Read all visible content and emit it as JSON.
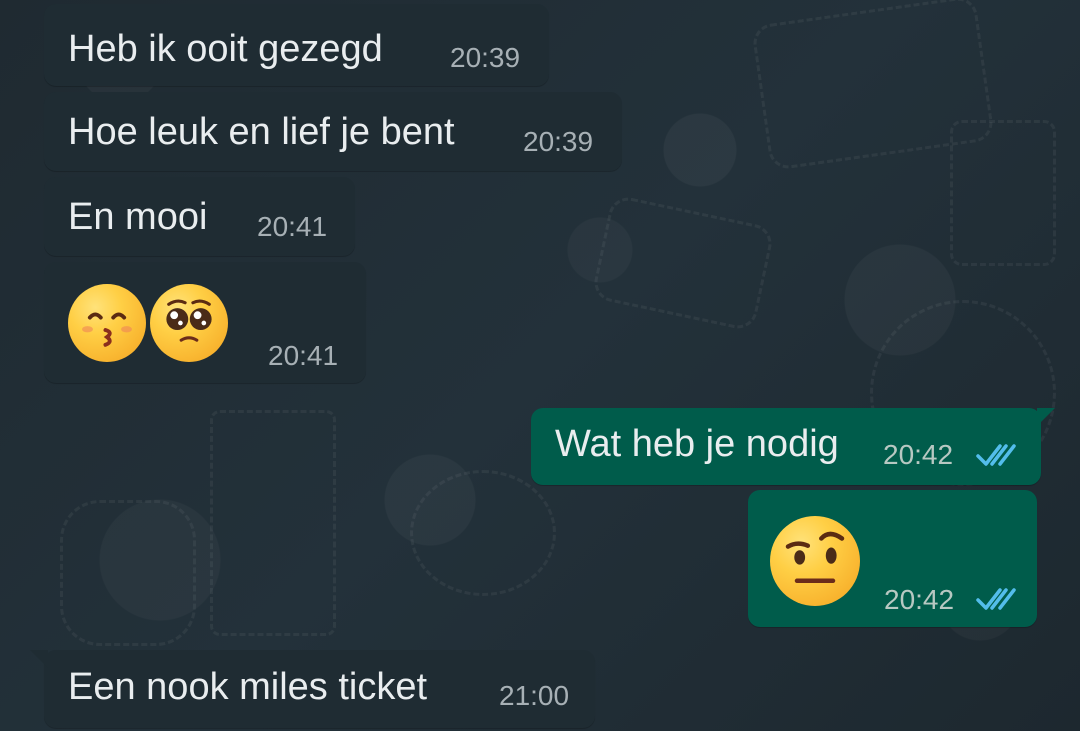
{
  "messages": [
    {
      "direction": "incoming",
      "text": "Heb ik ooit gezegd",
      "time": "20:39"
    },
    {
      "direction": "incoming",
      "text": "Hoe leuk en lief je bent",
      "time": "20:39"
    },
    {
      "direction": "incoming",
      "text": "En mooi",
      "time": "20:41"
    },
    {
      "direction": "incoming",
      "emojis": [
        "kissing-face-with-smiling-eyes",
        "pleading-face"
      ],
      "time": "20:41"
    },
    {
      "direction": "outgoing",
      "text": "Wat heb je nodig",
      "time": "20:42",
      "status": "read-double-check"
    },
    {
      "direction": "outgoing",
      "emojis": [
        "face-with-raised-eyebrow"
      ],
      "time": "20:42",
      "status": "read-double-check"
    },
    {
      "direction": "incoming",
      "text": "Een nook miles ticket",
      "time": "21:00"
    }
  ],
  "colors": {
    "background": "#202c33",
    "incoming_bubble": "#1f2c33",
    "outgoing_bubble": "#005c4b",
    "text": "#e9edef",
    "timestamp": "#a7b0b5",
    "read_ticks": "#53bdeb"
  }
}
